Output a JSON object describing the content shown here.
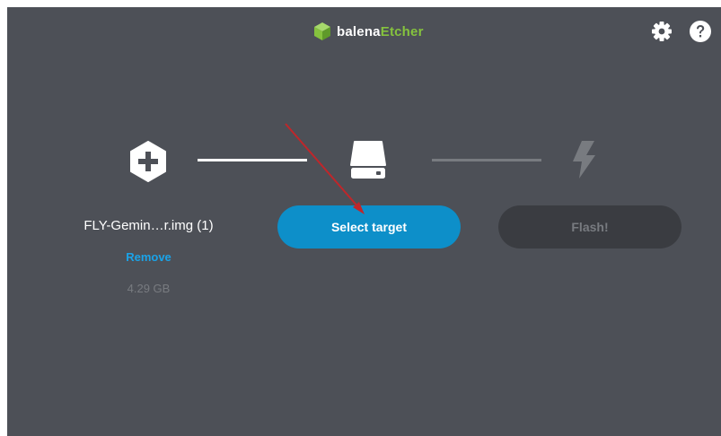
{
  "header": {
    "brand_part1": "balena",
    "brand_part2": "Etcher",
    "brand_color": "#85c23e",
    "icons": [
      "cube-logo-icon",
      "gear-icon",
      "help-circle-icon"
    ]
  },
  "steps": {
    "source": {
      "icon": "plus-hexagon-icon",
      "file_name": "FLY-Gemin…r.img (1)",
      "remove_label": "Remove",
      "file_size": "4.29 GB"
    },
    "target": {
      "icon": "drive-icon",
      "button_label": "Select target"
    },
    "flash": {
      "icon": "lightning-bolt-icon",
      "button_label": "Flash!"
    }
  },
  "colors": {
    "background": "#4d5057",
    "accent": "#0d8fc9",
    "link": "#1aa3e8",
    "disabled_button": "#3a3c41",
    "annotation_arrow": "#c0262a"
  }
}
